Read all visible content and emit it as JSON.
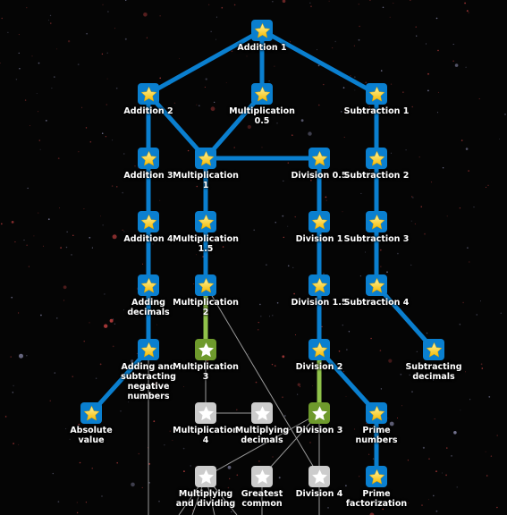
{
  "colors": {
    "background": "#050505",
    "mastered": "#0a7fcf",
    "proficient": "#6e9a2c",
    "unstarted": "#cccccc",
    "edge_mastered": "#0a7fcf",
    "edge_proficient": "#8fc24a",
    "edge_unstarted": "#9a9a9a",
    "star_gold": "#ffd21f",
    "star_white": "#ffffff"
  },
  "nodes": [
    {
      "id": "add1",
      "label": [
        "Addition 1"
      ],
      "status": "mastered"
    },
    {
      "id": "add2",
      "label": [
        "Addition 2"
      ],
      "status": "mastered"
    },
    {
      "id": "mul05",
      "label": [
        "Multiplication",
        "0.5"
      ],
      "status": "mastered"
    },
    {
      "id": "sub1",
      "label": [
        "Subtraction 1"
      ],
      "status": "mastered"
    },
    {
      "id": "add3",
      "label": [
        "Addition 3"
      ],
      "status": "mastered"
    },
    {
      "id": "mul1",
      "label": [
        "Multiplication",
        "1"
      ],
      "status": "mastered"
    },
    {
      "id": "div05",
      "label": [
        "Division 0.5"
      ],
      "status": "mastered"
    },
    {
      "id": "sub2",
      "label": [
        "Subtraction 2"
      ],
      "status": "mastered"
    },
    {
      "id": "add4",
      "label": [
        "Addition 4"
      ],
      "status": "mastered"
    },
    {
      "id": "mul15",
      "label": [
        "Multiplication",
        "1.5"
      ],
      "status": "mastered"
    },
    {
      "id": "div1",
      "label": [
        "Division 1"
      ],
      "status": "mastered"
    },
    {
      "id": "sub3",
      "label": [
        "Subtraction 3"
      ],
      "status": "mastered"
    },
    {
      "id": "adddec",
      "label": [
        "Adding",
        "decimals"
      ],
      "status": "mastered"
    },
    {
      "id": "mul2",
      "label": [
        "Multiplication",
        "2"
      ],
      "status": "mastered"
    },
    {
      "id": "div15",
      "label": [
        "Division 1.5"
      ],
      "status": "mastered"
    },
    {
      "id": "sub4",
      "label": [
        "Subtraction 4"
      ],
      "status": "mastered"
    },
    {
      "id": "addneg",
      "label": [
        "Adding and",
        "subtracting",
        "negative",
        "numbers"
      ],
      "status": "mastered"
    },
    {
      "id": "mul3",
      "label": [
        "Multiplication",
        "3"
      ],
      "status": "proficient"
    },
    {
      "id": "div2",
      "label": [
        "Division 2"
      ],
      "status": "mastered"
    },
    {
      "id": "subdec",
      "label": [
        "Subtracting",
        "decimals"
      ],
      "status": "mastered"
    },
    {
      "id": "absval",
      "label": [
        "Absolute",
        "value"
      ],
      "status": "mastered"
    },
    {
      "id": "mul4",
      "label": [
        "Multiplication",
        "4"
      ],
      "status": "unstarted"
    },
    {
      "id": "muldec",
      "label": [
        "Multiplying",
        "decimals"
      ],
      "status": "unstarted"
    },
    {
      "id": "div3",
      "label": [
        "Division 3"
      ],
      "status": "proficient"
    },
    {
      "id": "prime",
      "label": [
        "Prime",
        "numbers"
      ],
      "status": "mastered"
    },
    {
      "id": "muldiv",
      "label": [
        "Multiplying",
        "and dividing"
      ],
      "status": "unstarted"
    },
    {
      "id": "gcd",
      "label": [
        "Greatest",
        "common"
      ],
      "status": "unstarted"
    },
    {
      "id": "div4",
      "label": [
        "Division 4"
      ],
      "status": "unstarted"
    },
    {
      "id": "primefact",
      "label": [
        "Prime",
        "factorization"
      ],
      "status": "mastered"
    }
  ],
  "edges": [
    [
      "add1",
      "add2",
      "mastered"
    ],
    [
      "add1",
      "mul05",
      "mastered"
    ],
    [
      "add1",
      "sub1",
      "mastered"
    ],
    [
      "add2",
      "add3",
      "mastered"
    ],
    [
      "add2",
      "mul1",
      "mastered"
    ],
    [
      "mul05",
      "mul1",
      "mastered"
    ],
    [
      "mul1",
      "div05",
      "mastered"
    ],
    [
      "add3",
      "add4",
      "mastered"
    ],
    [
      "mul1",
      "mul15",
      "mastered"
    ],
    [
      "div05",
      "div1",
      "mastered"
    ],
    [
      "sub1",
      "sub2",
      "mastered"
    ],
    [
      "sub2",
      "sub3",
      "mastered"
    ],
    [
      "add4",
      "adddec",
      "mastered"
    ],
    [
      "mul15",
      "mul2",
      "mastered"
    ],
    [
      "div1",
      "div15",
      "mastered"
    ],
    [
      "sub3",
      "sub4",
      "mastered"
    ],
    [
      "adddec",
      "addneg",
      "mastered"
    ],
    [
      "div15",
      "div2",
      "mastered"
    ],
    [
      "sub4",
      "subdec",
      "mastered"
    ],
    [
      "addneg",
      "absval",
      "mastered"
    ],
    [
      "div2",
      "prime",
      "mastered"
    ],
    [
      "prime",
      "primefact",
      "mastered"
    ],
    [
      "mul2",
      "mul3",
      "proficient"
    ],
    [
      "div2",
      "div3",
      "proficient"
    ],
    [
      "mul2",
      "div4",
      "unstarted"
    ],
    [
      "mul3",
      "mul4",
      "unstarted"
    ],
    [
      "mul4",
      "muldec",
      "unstarted"
    ],
    [
      "div3",
      "muldiv",
      "unstarted"
    ],
    [
      "div3",
      "gcd",
      "unstarted"
    ],
    [
      "div3",
      "div4",
      "unstarted"
    ]
  ]
}
